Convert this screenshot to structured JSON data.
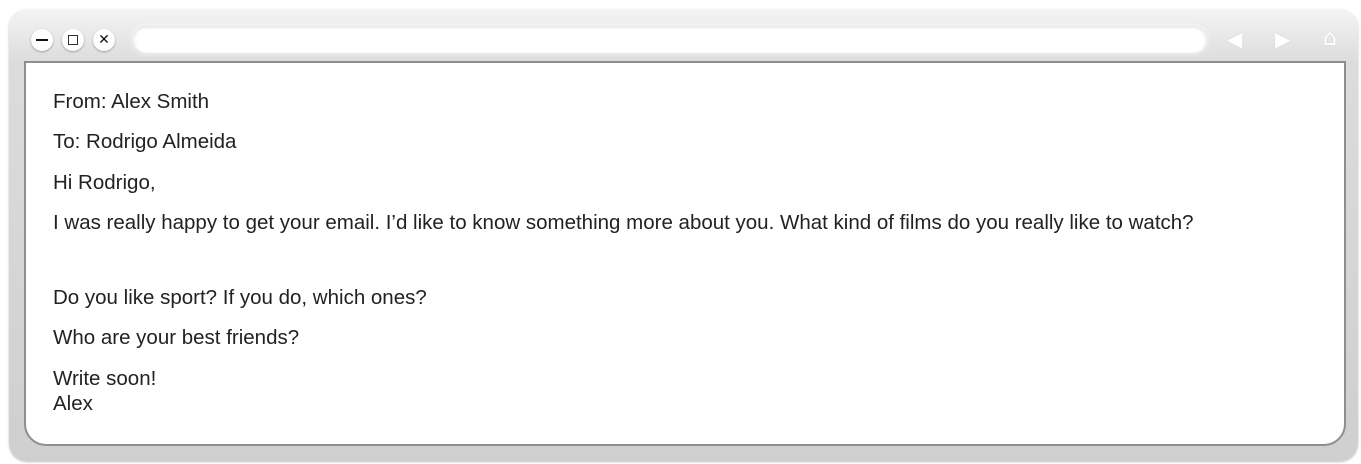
{
  "window": {
    "controls": {
      "minimize_icon": "minimize-icon",
      "maximize_icon": "maximize-icon",
      "close_icon": "close-icon",
      "close_glyph": "✕"
    },
    "address_bar": {
      "value": ""
    },
    "nav": {
      "back_glyph": "◀",
      "forward_glyph": "▶",
      "home_glyph": "⌂"
    }
  },
  "email": {
    "from": "From: Alex Smith",
    "to": "To: Rodrigo Almeida",
    "greeting": "Hi Rodrigo,",
    "paragraph_1": "I was really happy to get your email. I’d like to know something more about you. What kind of films do you really like to watch?",
    "paragraph_2": "Do you like sport? If you do, which ones?",
    "paragraph_3": "Who are your best friends?",
    "closing": "Write soon!",
    "signature": "Alex"
  }
}
